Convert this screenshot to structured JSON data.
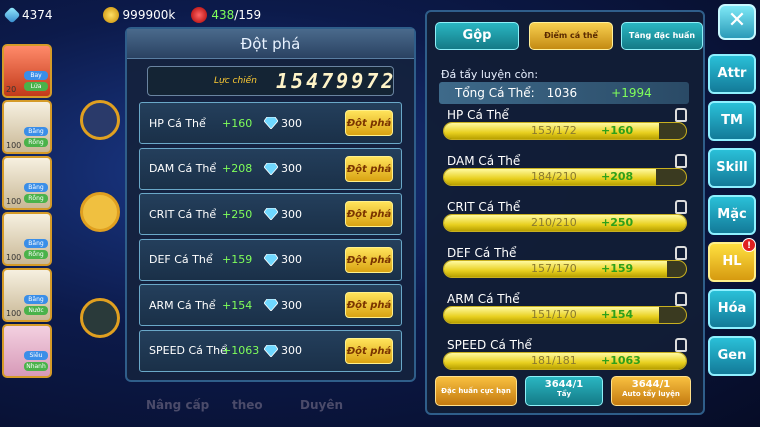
{
  "topbar": {
    "gems": "4374",
    "gold": "999900k",
    "stamina_current": "438",
    "stamina_max": "/159"
  },
  "heroes": [
    {
      "lvl": "20",
      "tag1": "Bay",
      "tag2": "Lửa"
    },
    {
      "lvl": "100",
      "tag1": "Băng",
      "tag2": "Rồng"
    },
    {
      "lvl": "100",
      "tag1": "Băng",
      "tag2": "Rồng"
    },
    {
      "lvl": "100",
      "tag1": "Băng",
      "tag2": "Rồng"
    },
    {
      "lvl": "100",
      "tag1": "Băng",
      "tag2": "Nước"
    },
    {
      "lvl": "",
      "tag1": "Siêu",
      "tag2": "Nhanh"
    }
  ],
  "bottomnav": [
    "Nâng cấp",
    "theo",
    "Duyên"
  ],
  "breakthrough": {
    "title": "Đột phá",
    "power_label": "Lực chiến",
    "power_value": "15479972",
    "rows": [
      {
        "label": "HP Cá Thể",
        "bonus": "+160",
        "cost": "300",
        "btn": "Đột phá"
      },
      {
        "label": "DAM Cá Thể",
        "bonus": "+208",
        "cost": "300",
        "btn": "Đột phá"
      },
      {
        "label": "CRIT Cá Thể",
        "bonus": "+250",
        "cost": "300",
        "btn": "Đột phá"
      },
      {
        "label": "DEF Cá Thể",
        "bonus": "+159",
        "cost": "300",
        "btn": "Đột phá"
      },
      {
        "label": "ARM Cá Thể",
        "bonus": "+154",
        "cost": "300",
        "btn": "Đột phá"
      },
      {
        "label": "SPEED Cá Thể",
        "bonus": "+1063",
        "cost": "300",
        "btn": "Đột phá"
      }
    ]
  },
  "training": {
    "tabs": [
      "Gộp",
      "Điểm cá thể",
      "Tăng đặc huấn"
    ],
    "remain_label": "Đá tẩy luyện còn:",
    "total_label": "Tổng Cá Thể:",
    "total_value": "1036",
    "total_bonus": "+1994",
    "stats": [
      {
        "name": "HP Cá Thể",
        "value": "153/172",
        "current": 153,
        "max": 172,
        "plus": "+160"
      },
      {
        "name": "DAM Cá Thể",
        "value": "184/210",
        "current": 184,
        "max": 210,
        "plus": "+208"
      },
      {
        "name": "CRIT Cá Thể",
        "value": "210/210",
        "current": 210,
        "max": 210,
        "plus": "+250"
      },
      {
        "name": "DEF Cá Thể",
        "value": "157/170",
        "current": 157,
        "max": 170,
        "plus": "+159"
      },
      {
        "name": "ARM Cá Thể",
        "value": "151/170",
        "current": 151,
        "max": 170,
        "plus": "+154"
      },
      {
        "name": "SPEED Cá Thể",
        "value": "181/181",
        "current": 181,
        "max": 181,
        "plus": "+1063"
      }
    ],
    "btn_special": "Đặc huấn cực hạn",
    "btn_wash_count": "3644/1",
    "btn_wash": "Tẩy",
    "btn_auto_count": "3644/1",
    "btn_auto": "Auto tẩy luyện"
  },
  "side_tabs": [
    "Attr",
    "TM",
    "Skill",
    "Mặc",
    "HL",
    "Hóa",
    "Gen"
  ],
  "colors": {
    "accent_gold": "#f8d050",
    "accent_teal": "#2ab6c2",
    "bonus_green": "#7fff5a"
  }
}
